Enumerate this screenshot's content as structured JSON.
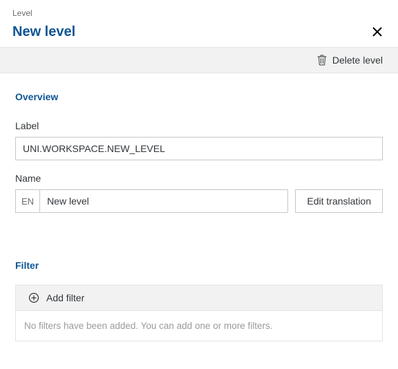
{
  "header": {
    "eyebrow": "Level",
    "title": "New level"
  },
  "toolbar": {
    "delete_label": "Delete level"
  },
  "overview": {
    "section_title": "Overview",
    "label_field_label": "Label",
    "label_value": "UNI.WORKSPACE.NEW_LEVEL",
    "name_field_label": "Name",
    "lang_code": "EN",
    "name_value": "New level",
    "edit_translation_label": "Edit translation"
  },
  "filter": {
    "section_title": "Filter",
    "add_filter_label": "Add filter",
    "empty_message": "No filters have been added. You can add one or more filters."
  }
}
